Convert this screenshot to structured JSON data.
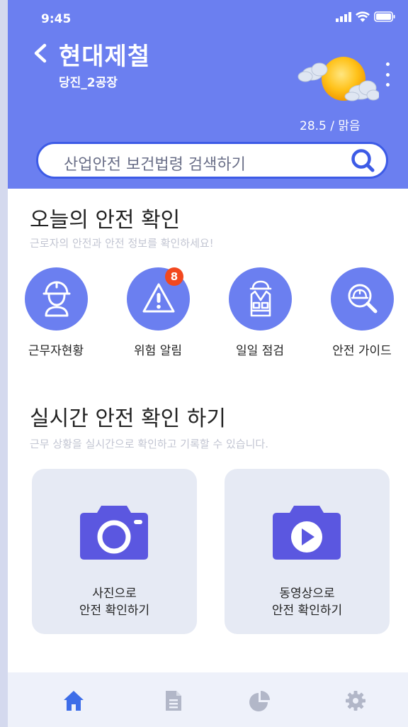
{
  "status": {
    "time": "9:45"
  },
  "header": {
    "company": "현대제철",
    "plant": "당진_2공장",
    "weather": "28.5 / 맑음"
  },
  "search": {
    "placeholder": "산업안전 보건법령 검색하기"
  },
  "today": {
    "title": "오늘의 안전 확인",
    "subtitle": "근로자의 안전과 안전 정보를 확인하세요!",
    "items": [
      {
        "label": "근무자현황",
        "icon": "worker-helmet-icon"
      },
      {
        "label": "위험 알림",
        "icon": "warning-icon",
        "badge": "8"
      },
      {
        "label": "일일 점검",
        "icon": "safety-vest-icon"
      },
      {
        "label": "안전 가이드",
        "icon": "search-helmet-icon"
      }
    ]
  },
  "realtime": {
    "title": "실시간 안전 확인 하기",
    "subtitle": "근무 상황을 실시간으로 확인하고 기록할 수 있습니다.",
    "cards": [
      {
        "line1": "사진으로",
        "line2": "안전 확인하기",
        "icon": "camera-icon"
      },
      {
        "line1": "동영상으로",
        "line2": "안전 확인하기",
        "icon": "video-camera-icon"
      }
    ]
  },
  "tabbar": {
    "tabs": [
      "home-icon",
      "document-icon",
      "pie-chart-icon",
      "gear-icon"
    ],
    "active": "home-icon"
  },
  "colors": {
    "primary": "#6b7ff0",
    "search_border": "#3d5be6",
    "badge": "#f2481f",
    "card_bg": "#e6eaf4",
    "card_icon": "#5b57e0",
    "tab_active": "#3d6de8",
    "tab_inactive": "#b2b7c8"
  }
}
